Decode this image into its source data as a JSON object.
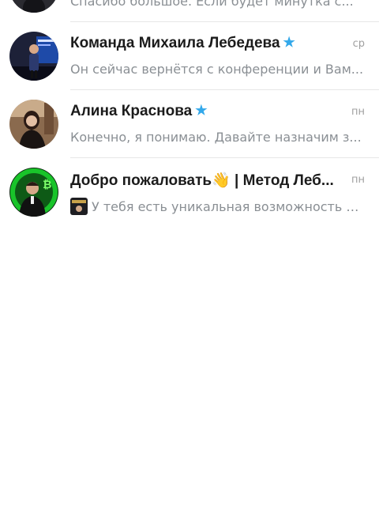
{
  "chats": [
    {
      "preview": "Спасибо большое. Если будет минутка с..."
    },
    {
      "title": "Команда Михаила Лебедева",
      "verified_icon": "verified-star-icon",
      "time": "ср",
      "preview": "Он сейчас вернётся с конференции и Вам..."
    },
    {
      "title": "Алина Краснова",
      "verified_icon": "verified-star-icon",
      "time": "пн",
      "preview": "Конечно, я понимаю. Давайте назначим з..."
    },
    {
      "title": "Добро пожаловать👋 | Метод Леб...",
      "time": "пн",
      "preview": "У тебя есть уникальная возможность у..."
    }
  ],
  "colors": {
    "accent_star": "#33a8ea",
    "title": "#1b1b1b",
    "preview": "#8a8f94",
    "time": "#a0a0a0"
  }
}
